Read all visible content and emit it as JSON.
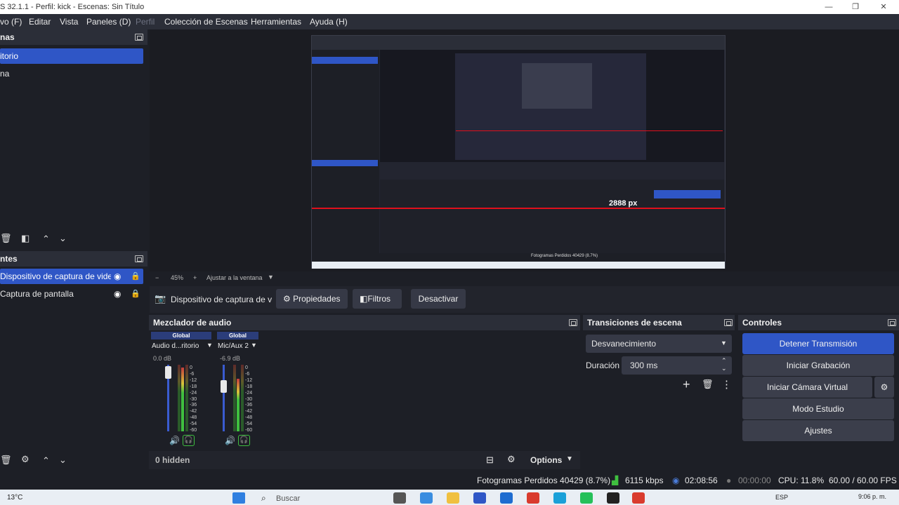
{
  "window": {
    "title": "S 32.1.1 - Perfil: kick - Escenas: Sin Título",
    "minimize": "—",
    "maximize": "❐",
    "close": "✕"
  },
  "menu": [
    "vo (F)",
    "Editar",
    "Vista",
    "Paneles (D)",
    "Perfil",
    "Colección de Escenas",
    "Herramientas",
    "Ayuda (H)"
  ],
  "scenes": {
    "title": "nas",
    "items": [
      "itorio",
      "na"
    ]
  },
  "sources": {
    "title": "ntes",
    "items": [
      "Dispositivo de captura de video",
      "Captura de pantalla"
    ]
  },
  "preview_toolbar": {
    "zoom_minus": "−",
    "zoom": "45%",
    "zoom_plus": "+",
    "fit": "Ajustar a la ventana"
  },
  "source_toolbar": {
    "selected": "Dispositivo de captura de v",
    "properties": "Propiedades",
    "filters": "Filtros",
    "deactivate": "Desactivar"
  },
  "mixer": {
    "title": "Mezclador de audio",
    "channels": [
      {
        "global": "Global",
        "name": "Audio d...ritorio",
        "db": "0.0 dB",
        "level": 0.95
      },
      {
        "global": "Global",
        "name": "Mic/Aux 2",
        "db": "-6.9 dB",
        "level": 0.7
      }
    ],
    "ticks": [
      "0",
      "-6",
      "-12",
      "-18",
      "-24",
      "-30",
      "-36",
      "-42",
      "-48",
      "-54",
      "-60"
    ],
    "hidden": "0 hidden",
    "options": "Options"
  },
  "transitions": {
    "title": "Transiciones de escena",
    "selected": "Desvanecimiento",
    "duration_label": "Duración",
    "duration_value": "300 ms"
  },
  "controls": {
    "title": "Controles",
    "stop_stream": "Detener Transmisión",
    "start_recording": "Iniciar Grabación",
    "virtual_cam": "Iniciar Cámara Virtual",
    "studio_mode": "Modo Estudio",
    "settings": "Ajustes"
  },
  "status": {
    "dropped": "Fotogramas Perdidos 40429 (8.7%)",
    "bitrate": "6115 kbps",
    "stream_time": "02:08:56",
    "rec_time": "00:00:00",
    "cpu": "CPU: 11.8%",
    "fps": "60.00 / 60.00 FPS"
  },
  "preview_inner": {
    "px_value": "2888 px",
    "dropped": "Fotogramas Perdidos 40429 (8.7%)"
  },
  "taskbar": {
    "weather": "13°C",
    "search": "Buscar",
    "lang": "ESP",
    "time": "9:06 p. m."
  },
  "colors": {
    "accent": "#2f56c6",
    "bg": "#1d1f26",
    "dock": "#2b2e38",
    "red_line": "#e0101c"
  }
}
